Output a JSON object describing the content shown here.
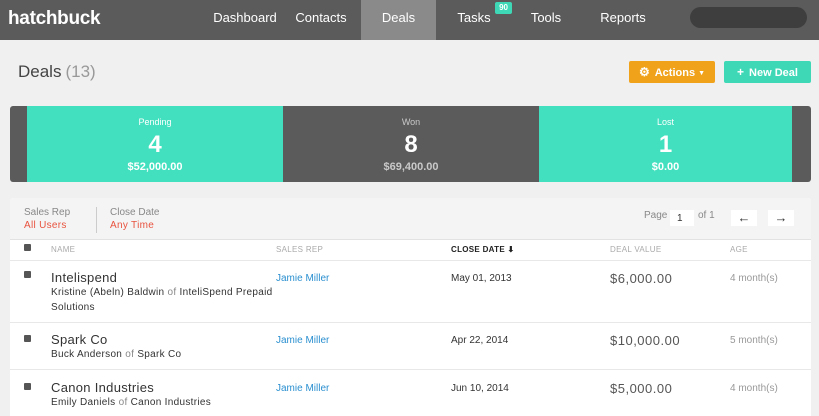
{
  "app": {
    "logo": "hatchbuck"
  },
  "nav": {
    "items": [
      {
        "label": "Dashboard"
      },
      {
        "label": "Contacts"
      },
      {
        "label": "Deals"
      },
      {
        "label": "Tasks",
        "badge": "90"
      },
      {
        "label": "Tools"
      },
      {
        "label": "Reports"
      }
    ],
    "search_placeholder": ""
  },
  "header": {
    "title": "Deals",
    "count": "(13)",
    "actions_label": "Actions",
    "new_deal_label": "New Deal"
  },
  "summary": {
    "pending": {
      "label": "Pending",
      "count": "4",
      "amount": "$52,000.00"
    },
    "won": {
      "label": "Won",
      "count": "8",
      "amount": "$69,400.00"
    },
    "lost": {
      "label": "Lost",
      "count": "1",
      "amount": "$0.00"
    }
  },
  "filters": {
    "sales_rep_label": "Sales Rep",
    "sales_rep_value": "All Users",
    "close_date_label": "Close Date",
    "close_date_value": "Any Time"
  },
  "pager": {
    "page_label": "Page",
    "page_value": "1",
    "of_label": "of 1",
    "prev": "←",
    "next": "→"
  },
  "table": {
    "columns": {
      "name": "NAME",
      "sales_rep": "SALES REP",
      "close_date": "CLOSE DATE ⬇",
      "deal_value": "DEAL VALUE",
      "age": "AGE"
    },
    "rows": [
      {
        "name": "Intelispend",
        "contact": "Kristine (Abeln) Baldwin",
        "of": "of",
        "company": "InteliSpend Prepaid Solutions",
        "rep": "Jamie Miller",
        "close_date": "May 01, 2013",
        "value": "$6,000.00",
        "age": "4 month(s)"
      },
      {
        "name": "Spark Co",
        "contact": "Buck Anderson",
        "of": "of",
        "company": "Spark Co",
        "rep": "Jamie Miller",
        "close_date": "Apr 22, 2014",
        "value": "$10,000.00",
        "age": "5 month(s)"
      },
      {
        "name": "Canon Industries",
        "contact": "Emily Daniels",
        "of": "of",
        "company": "Canon Industries",
        "rep": "Jamie Miller",
        "close_date": "Jun 10, 2014",
        "value": "$5,000.00",
        "age": "4 month(s)"
      }
    ]
  },
  "colors": {
    "teal": "#43e0bf",
    "orange": "#f0a21b",
    "nav": "#5b5b5b",
    "link": "#2a8fd0",
    "filter_value": "#e8533f"
  },
  "icons": {
    "actions": "gear-icon",
    "new_deal": "plus-icon",
    "sort": "sort-desc-icon"
  }
}
